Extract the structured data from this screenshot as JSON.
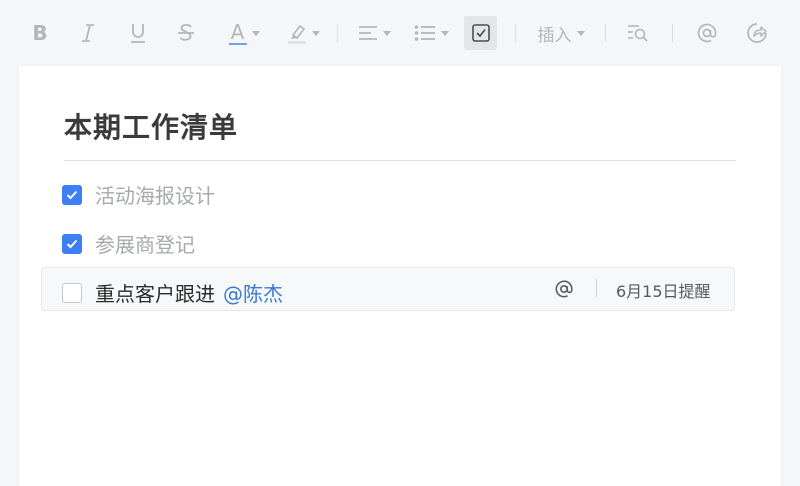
{
  "toolbar": {
    "bold_glyph": "B",
    "font_color_glyph": "A",
    "insert_label": "插入",
    "icons": [
      "bold-icon",
      "italic-icon",
      "underline-icon",
      "strikethrough-icon",
      "font-color-icon",
      "highlight-icon",
      "align-icon",
      "list-icon",
      "task-checkbox-icon",
      "insert-menu",
      "find-icon",
      "mention-icon",
      "share-icon"
    ],
    "active_tool": "task-checkbox"
  },
  "document": {
    "title": "本期工作清单",
    "tasks": [
      {
        "text": "活动海报设计",
        "checked": true
      },
      {
        "text": "参展商登记",
        "checked": true
      },
      {
        "text": "重点客户跟进",
        "checked": false,
        "mention": "@陈杰",
        "reminder": "6月15日提醒"
      }
    ]
  },
  "colors": {
    "accent": "#3d7ff2",
    "mention": "#3a78d6",
    "done_text": "#a6a9ad"
  }
}
